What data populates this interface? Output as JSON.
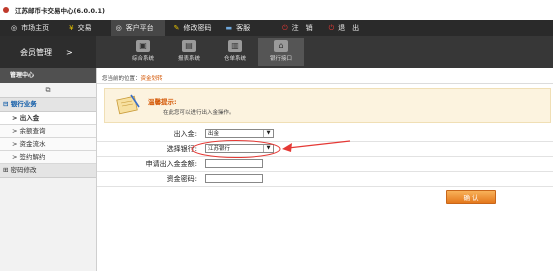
{
  "window": {
    "title": "江苏邮币卡交易中心(6.0.0.1)"
  },
  "top_nav": {
    "items": [
      {
        "label": "市场主页",
        "icon": "globe-icon"
      },
      {
        "label": "交易",
        "icon": "trade-icon"
      },
      {
        "label": "客户平台",
        "icon": "customer-icon",
        "active": true
      },
      {
        "label": "修改密码",
        "icon": "key-icon"
      },
      {
        "label": "客服",
        "icon": "service-icon"
      },
      {
        "label": "注　销",
        "icon": "power-icon"
      },
      {
        "label": "退　出",
        "icon": "exit-icon"
      }
    ]
  },
  "sub_nav": {
    "brand": "会员管理",
    "brand_arrow": ">",
    "tabs": [
      {
        "label": "综合系统"
      },
      {
        "label": "报表系统"
      },
      {
        "label": "仓单系统"
      },
      {
        "label": "银行接口",
        "active": true
      }
    ]
  },
  "sidebar": {
    "header": "管理中心",
    "groups": [
      {
        "label": "银行业务",
        "expanded": true,
        "items": [
          "出入金",
          "余额查询",
          "资金流水",
          "签约解约"
        ]
      },
      {
        "label": "密码修改",
        "expanded": false
      }
    ]
  },
  "breadcrumb": {
    "prefix": "您当前的位置：",
    "current": "资金划转"
  },
  "tip": {
    "title": "温馨提示:",
    "message": "在此您可以进行出入金操作。"
  },
  "form": {
    "direction_label": "出入金:",
    "direction_value": "出金",
    "bank_label": "选择银行:",
    "bank_value": "江苏银行",
    "amount_label": "申请出入金金额:",
    "amount_value": "",
    "password_label": "资金密码:",
    "password_value": "",
    "submit_label": "确 认"
  },
  "colors": {
    "accent": "#e4781c",
    "annotation": "#e53935"
  }
}
